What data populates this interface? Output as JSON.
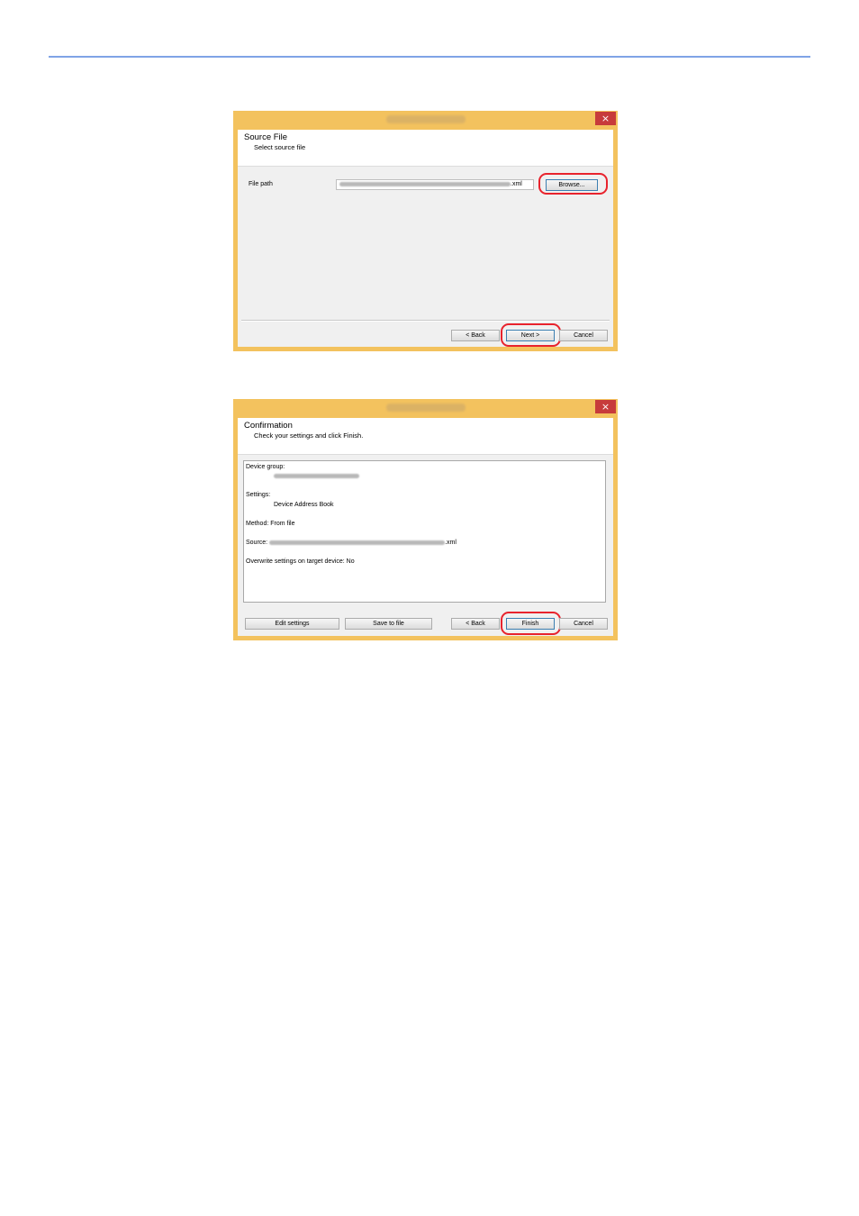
{
  "colors": {
    "accent_rule": "#7fa3e6",
    "window_frame": "#f3c25e",
    "close_button": "#c73b3b",
    "highlight": "#e8232d"
  },
  "dialog1": {
    "close_icon": "×",
    "header_title": "Source File",
    "header_subtitle": "Select source file",
    "file_path_label": "File path",
    "file_path_value_suffix": ".xml",
    "browse_label": "Browse...",
    "back_label": "< Back",
    "next_label": "Next >",
    "cancel_label": "Cancel"
  },
  "dialog2": {
    "close_icon": "×",
    "header_title": "Confirmation",
    "header_subtitle": "Check your settings and click Finish.",
    "summary": {
      "device_group_label": "Device group:",
      "settings_label": "Settings:",
      "settings_value": "Device Address Book",
      "method": "Method: From file",
      "source_label": "Source:",
      "source_suffix": ".xml",
      "overwrite": "Overwrite settings on target device: No"
    },
    "edit_settings_label": "Edit settings",
    "save_to_file_label": "Save to file",
    "back_label": "< Back",
    "finish_label": "Finish",
    "cancel_label": "Cancel"
  }
}
